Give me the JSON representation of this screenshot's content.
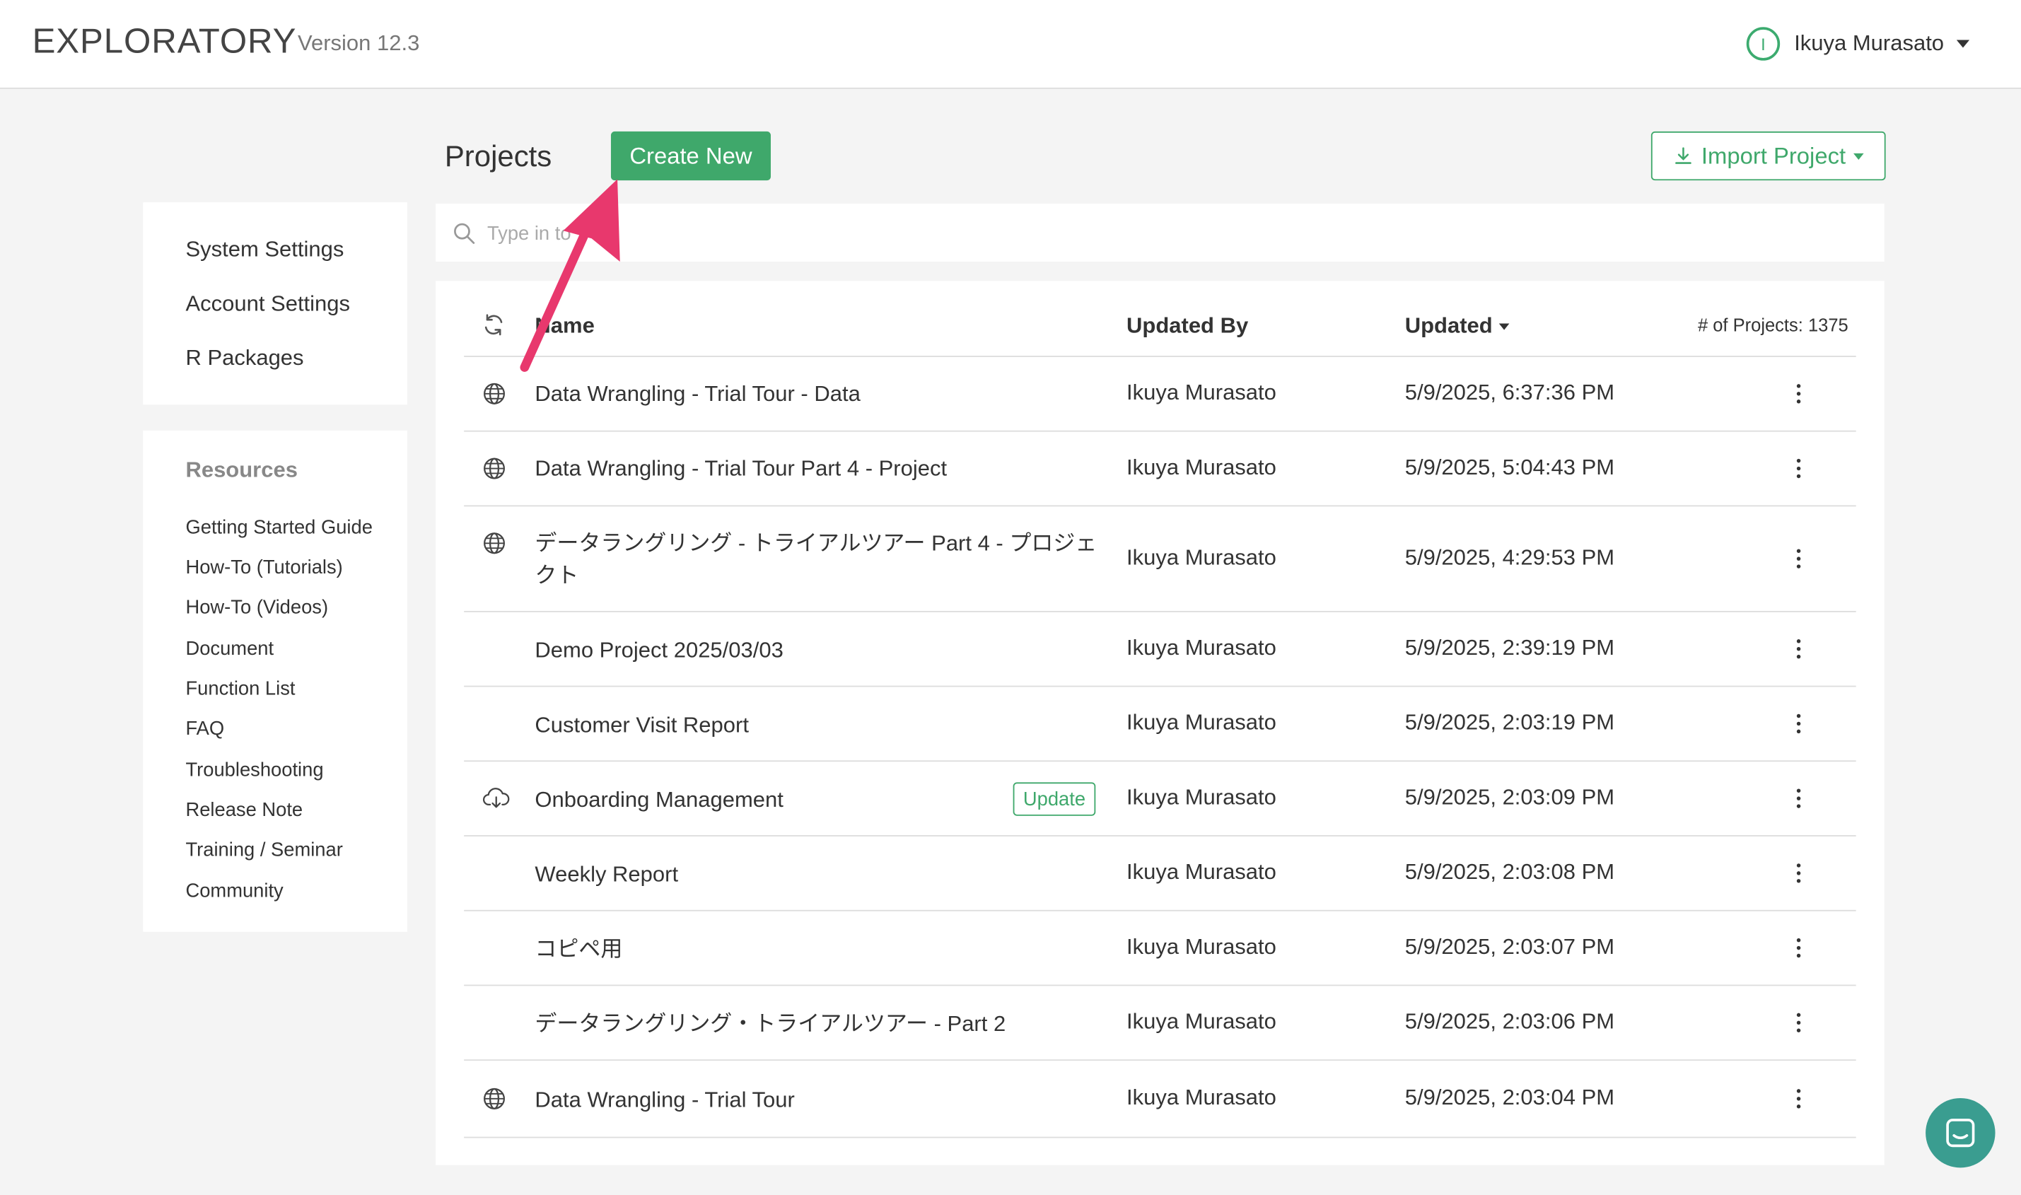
{
  "header": {
    "logo": "EXPLORATORY",
    "version": "Version 12.3",
    "user_initial": "I",
    "user_name": "Ikuya Murasato"
  },
  "sidebar": {
    "settings": [
      {
        "label": "System Settings"
      },
      {
        "label": "Account Settings"
      },
      {
        "label": "R Packages"
      }
    ],
    "resources_title": "Resources",
    "resources": [
      {
        "label": "Getting Started Guide"
      },
      {
        "label": "How-To (Tutorials)"
      },
      {
        "label": "How-To (Videos)"
      },
      {
        "label": "Document"
      },
      {
        "label": "Function List"
      },
      {
        "label": "FAQ"
      },
      {
        "label": "Troubleshooting"
      },
      {
        "label": "Release Note"
      },
      {
        "label": "Training / Seminar"
      },
      {
        "label": "Community"
      }
    ]
  },
  "main": {
    "title": "Projects",
    "create_label": "Create New",
    "import_label": "Import Project",
    "search_placeholder": "Type in to",
    "table": {
      "col_name": "Name",
      "col_updated_by": "Updated By",
      "col_updated": "Updated",
      "project_count": "# of Projects: 1375",
      "update_badge": "Update",
      "rows": [
        {
          "icon": "globe-icon",
          "name": "Data Wrangling - Trial Tour - Data",
          "updated_by": "Ikuya Murasato",
          "updated": "5/9/2025, 6:37:36 PM"
        },
        {
          "icon": "globe-icon",
          "name": "Data Wrangling - Trial Tour Part 4 - Project",
          "updated_by": "Ikuya Murasato",
          "updated": "5/9/2025, 5:04:43 PM"
        },
        {
          "icon": "globe-icon",
          "name": "データラングリング - トライアルツアー Part 4 - プロジェクト",
          "updated_by": "Ikuya Murasato",
          "updated": "5/9/2025, 4:29:53 PM"
        },
        {
          "icon": "",
          "name": "Demo Project 2025/03/03",
          "updated_by": "Ikuya Murasato",
          "updated": "5/9/2025, 2:39:19 PM"
        },
        {
          "icon": "",
          "name": "Customer Visit Report",
          "updated_by": "Ikuya Murasato",
          "updated": "5/9/2025, 2:03:19 PM"
        },
        {
          "icon": "cloud-download-icon",
          "name": "Onboarding Management",
          "updated_by": "Ikuya Murasato",
          "updated": "5/9/2025, 2:03:09 PM"
        },
        {
          "icon": "",
          "name": "Weekly Report",
          "updated_by": "Ikuya Murasato",
          "updated": "5/9/2025, 2:03:08 PM"
        },
        {
          "icon": "",
          "name": "コピペ用",
          "updated_by": "Ikuya Murasato",
          "updated": "5/9/2025, 2:03:07 PM"
        },
        {
          "icon": "",
          "name": "データラングリング・トライアルツアー - Part 2",
          "updated_by": "Ikuya Murasato",
          "updated": "5/9/2025, 2:03:06 PM"
        },
        {
          "icon": "globe-icon",
          "name": "Data Wrangling - Trial Tour",
          "updated_by": "Ikuya Murasato",
          "updated": "5/9/2025, 2:03:04 PM"
        }
      ]
    }
  },
  "colors": {
    "accent": "#3fa86b",
    "annotation_arrow": "#e8386d",
    "chat": "#3a9d90"
  }
}
